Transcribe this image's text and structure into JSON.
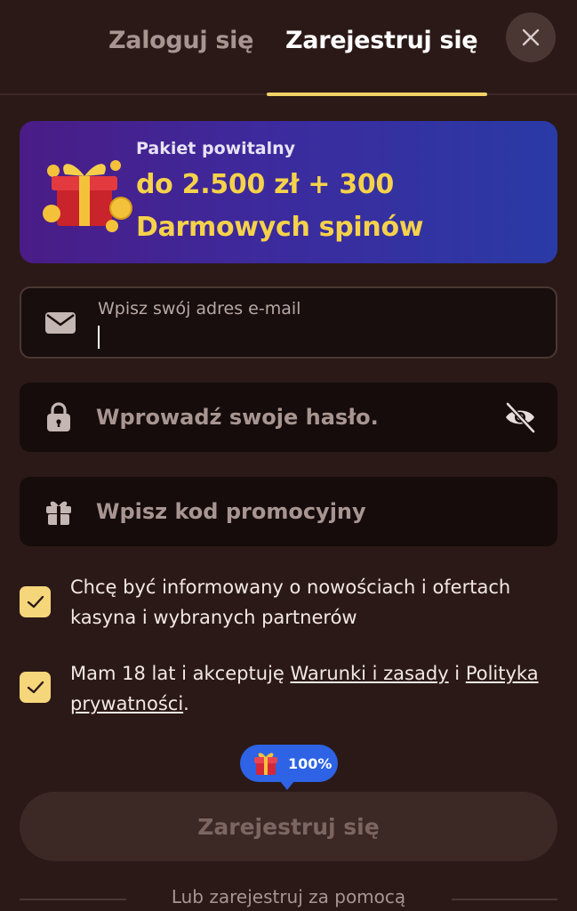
{
  "tabs": {
    "login": "Zaloguj się",
    "register": "Zarejestruj się",
    "active": "register"
  },
  "banner": {
    "subtitle": "Pakiet powitalny",
    "line1": "do 2.500 zł + 300",
    "line2": "Darmowych spinów"
  },
  "form": {
    "email": {
      "label": "Wpisz swój adres e-mail",
      "value": ""
    },
    "password": {
      "placeholder": "Wprowadź swoje hasło."
    },
    "promo": {
      "placeholder": "Wpisz kod promocyjny"
    }
  },
  "consents": {
    "marketing": {
      "checked": true,
      "text": "Chcę być informowany o nowościach i ofertach kasyna i wybranych partnerów"
    },
    "terms": {
      "checked": true,
      "prefix": "Mam 18 lat i akceptuję ",
      "terms_link": "Warunki i zasady",
      "middle": " i ",
      "privacy_link": "Polityka prywatności",
      "suffix": "."
    }
  },
  "progress": {
    "label": "100%",
    "percent": 100
  },
  "submit": {
    "label": "Zarejestruj się"
  },
  "divider": {
    "text": "Lub zarejestruj za pomocą"
  },
  "colors": {
    "background": "#2b1917",
    "accent": "#f2d267",
    "bubble": "#2d63e4",
    "banner_text": "#f5d24a"
  },
  "icons": [
    "close-icon",
    "gift-box-icon",
    "envelope-icon",
    "lock-icon",
    "eye-off-icon",
    "gift-icon",
    "check-icon"
  ]
}
